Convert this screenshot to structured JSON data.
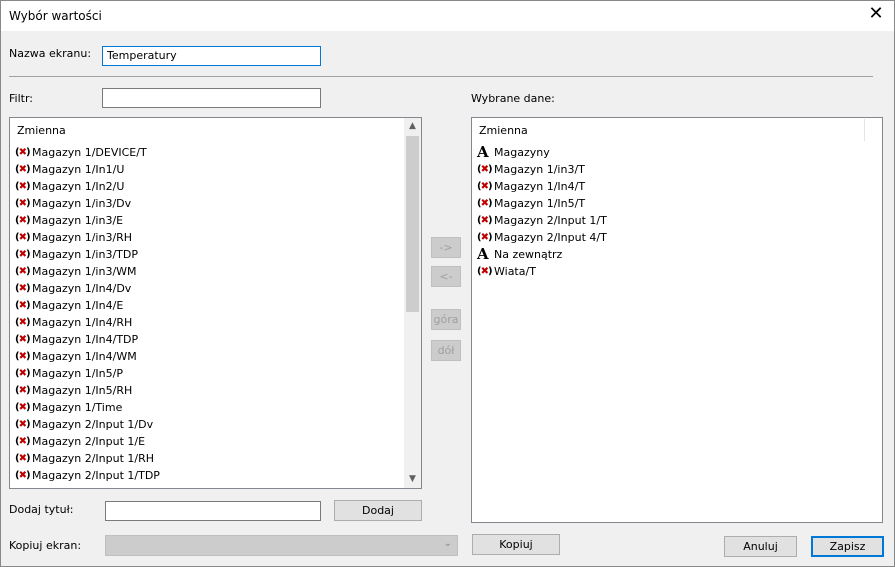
{
  "window": {
    "title": "Wybór wartości"
  },
  "form": {
    "screen_name_label": "Nazwa ekranu:",
    "screen_name_value": "Temperatury",
    "filter_label": "Filtr:",
    "filter_value": "",
    "selected_label": "Wybrane dane:",
    "add_title_label": "Dodaj tytuł:",
    "add_title_value": "",
    "copy_screen_label": "Kopiuj ekran:"
  },
  "left_list": {
    "header": "Zmienna",
    "items": [
      {
        "label": "Magazyn 1/DEVICE/T",
        "icon": "variable-icon"
      },
      {
        "label": "Magazyn 1/In1/U",
        "icon": "variable-icon"
      },
      {
        "label": "Magazyn 1/In2/U",
        "icon": "variable-icon"
      },
      {
        "label": "Magazyn 1/in3/Dv",
        "icon": "variable-icon"
      },
      {
        "label": "Magazyn 1/in3/E",
        "icon": "variable-icon"
      },
      {
        "label": "Magazyn 1/in3/RH",
        "icon": "variable-icon"
      },
      {
        "label": "Magazyn 1/in3/TDP",
        "icon": "variable-icon"
      },
      {
        "label": "Magazyn 1/in3/WM",
        "icon": "variable-icon"
      },
      {
        "label": "Magazyn 1/In4/Dv",
        "icon": "variable-icon"
      },
      {
        "label": "Magazyn 1/In4/E",
        "icon": "variable-icon"
      },
      {
        "label": "Magazyn 1/In4/RH",
        "icon": "variable-icon"
      },
      {
        "label": "Magazyn 1/In4/TDP",
        "icon": "variable-icon"
      },
      {
        "label": "Magazyn 1/In4/WM",
        "icon": "variable-icon"
      },
      {
        "label": "Magazyn 1/In5/P",
        "icon": "variable-icon"
      },
      {
        "label": "Magazyn 1/In5/RH",
        "icon": "variable-icon"
      },
      {
        "label": "Magazyn 1/Time",
        "icon": "variable-icon"
      },
      {
        "label": "Magazyn 2/Input 1/Dv",
        "icon": "variable-icon"
      },
      {
        "label": "Magazyn 2/Input 1/E",
        "icon": "variable-icon"
      },
      {
        "label": "Magazyn 2/Input 1/RH",
        "icon": "variable-icon"
      },
      {
        "label": "Magazyn 2/Input 1/TDP",
        "icon": "variable-icon"
      }
    ]
  },
  "right_list": {
    "header": "Zmienna",
    "items": [
      {
        "label": "Magazyny",
        "icon": "title-icon"
      },
      {
        "label": "Magazyn 1/in3/T",
        "icon": "variable-icon"
      },
      {
        "label": "Magazyn 1/In4/T",
        "icon": "variable-icon"
      },
      {
        "label": "Magazyn 1/In5/T",
        "icon": "variable-icon"
      },
      {
        "label": "Magazyn 2/Input 1/T",
        "icon": "variable-icon"
      },
      {
        "label": "Magazyn 2/Input 4/T",
        "icon": "variable-icon"
      },
      {
        "label": "Na zewnątrz",
        "icon": "title-icon"
      },
      {
        "label": "Wiata/T",
        "icon": "variable-icon"
      }
    ]
  },
  "buttons": {
    "move_right": "->",
    "move_left": "<-",
    "up": "góra",
    "down": "dół",
    "add": "Dodaj",
    "copy": "Kopiuj",
    "cancel": "Anuluj",
    "save": "Zapisz"
  },
  "icons": {
    "close": "close-icon",
    "scroll_up": "chevron-up-icon",
    "scroll_down": "chevron-down-icon",
    "combo": "chevron-down-icon"
  },
  "colors": {
    "focus_border": "#0078d7",
    "variable_icon_x": "#c00000"
  }
}
